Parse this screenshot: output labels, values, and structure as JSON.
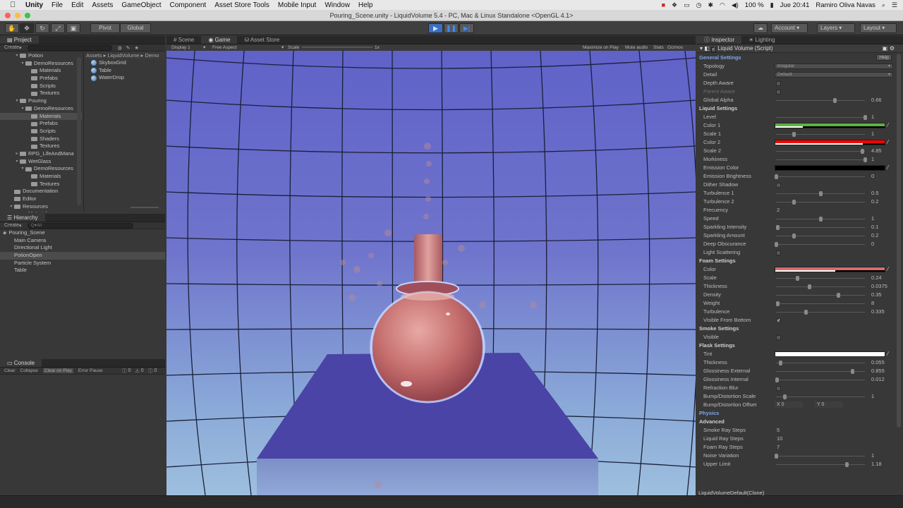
{
  "menubar": {
    "items": [
      "Unity",
      "File",
      "Edit",
      "Assets",
      "GameObject",
      "Component",
      "Asset Store Tools",
      "Mobile Input",
      "Window",
      "Help"
    ],
    "battery": "100 %",
    "clock": "Jue 20:41",
    "user": "Ramiro Oliva Navas"
  },
  "window": {
    "title": "Pouring_Scene.unity - LiquidVolume 5.4 - PC, Mac & Linux Standalone <OpenGL 4.1>"
  },
  "toolbar": {
    "pivot": "Pivot",
    "global": "Global",
    "account": "Account",
    "layers": "Layers",
    "layout": "Layout"
  },
  "project": {
    "tab": "Project",
    "create": "Create",
    "breadcrumb": "Assets ▸ LiquidVolume ▸ Demo",
    "tree": [
      {
        "label": "Potion",
        "indent": 3,
        "expanded": true
      },
      {
        "label": "DemoResources",
        "indent": 4,
        "expanded": true
      },
      {
        "label": "Materials",
        "indent": 5
      },
      {
        "label": "Prefabs",
        "indent": 5
      },
      {
        "label": "Scripts",
        "indent": 5
      },
      {
        "label": "Textures",
        "indent": 5
      },
      {
        "label": "Pouring",
        "indent": 3,
        "expanded": true
      },
      {
        "label": "DemoResources",
        "indent": 4,
        "expanded": true
      },
      {
        "label": "Materials",
        "indent": 5,
        "selected": true
      },
      {
        "label": "Prefabs",
        "indent": 5
      },
      {
        "label": "Scripts",
        "indent": 5
      },
      {
        "label": "Shaders",
        "indent": 5
      },
      {
        "label": "Textures",
        "indent": 5
      },
      {
        "label": "RPG_LifeAndMana",
        "indent": 3,
        "collapsed": true
      },
      {
        "label": "WetGlass",
        "indent": 3,
        "expanded": true
      },
      {
        "label": "DemoResources",
        "indent": 4,
        "expanded": true
      },
      {
        "label": "Materials",
        "indent": 5
      },
      {
        "label": "Textures",
        "indent": 5
      },
      {
        "label": "Documentation",
        "indent": 2
      },
      {
        "label": "Editor",
        "indent": 2
      },
      {
        "label": "Resources",
        "indent": 2,
        "expanded": true
      },
      {
        "label": "Materials",
        "indent": 3
      }
    ],
    "files": [
      "SkyboxGrid",
      "Table",
      "WaterDrop"
    ]
  },
  "hierarchy": {
    "tab": "Hierarchy",
    "create": "Create",
    "search_placeholder": "Q▾All",
    "scene": "Pouring_Scene",
    "items": [
      {
        "label": "Main Camera"
      },
      {
        "label": "Directional Light"
      },
      {
        "label": "PotionOpen",
        "selected": true
      },
      {
        "label": "Particle System"
      },
      {
        "label": "Table"
      }
    ]
  },
  "console": {
    "tab": "Console",
    "buttons": [
      "Clear",
      "Collapse",
      "Clear on Play",
      "Error Pause"
    ],
    "counts": [
      "0",
      "0",
      "0"
    ]
  },
  "game": {
    "tabs": [
      "Scene",
      "Game",
      "Asset Store"
    ],
    "display": "Display 1",
    "aspect": "Free Aspect",
    "scale_label": "Scale",
    "scale_value": "1x",
    "options": [
      "Maximize on Play",
      "Mute audio",
      "Stats",
      "Gizmos"
    ]
  },
  "inspector": {
    "tabs": [
      "Inspector",
      "Lighting"
    ],
    "component": "Liquid Volume (Script)",
    "help": "Help",
    "rows": [
      {
        "type": "section",
        "label": "General Settings",
        "link": true
      },
      {
        "type": "dropdown",
        "label": "Topology",
        "value": "Irregular"
      },
      {
        "type": "dropdown",
        "label": "Detail",
        "value": "Default"
      },
      {
        "type": "check",
        "label": "Depth Aware",
        "checked": false
      },
      {
        "type": "check",
        "label": "Parent Aware",
        "checked": false,
        "disabled": true
      },
      {
        "type": "slider",
        "label": "Global Alpha",
        "value": "0.66",
        "pos": 0.66
      },
      {
        "type": "section",
        "label": "Liquid Settings"
      },
      {
        "type": "slider",
        "label": "Level",
        "value": "1",
        "pos": 1.0
      },
      {
        "type": "color",
        "label": "Color 1",
        "color": "#5cb444",
        "alpha": 0.25
      },
      {
        "type": "slider",
        "label": "Scale 1",
        "value": "1",
        "pos": 0.2
      },
      {
        "type": "color",
        "label": "Color 2",
        "color": "#ff0000",
        "alpha": 0.8
      },
      {
        "type": "slider",
        "label": "Scale 2",
        "value": "4.85",
        "pos": 0.97
      },
      {
        "type": "slider",
        "label": "Murkiness",
        "value": "1",
        "pos": 1.0
      },
      {
        "type": "color",
        "label": "Emission Color",
        "color": "#000000",
        "alpha": 0
      },
      {
        "type": "slider",
        "label": "Emission Brightness",
        "value": "0",
        "pos": 0.0
      },
      {
        "type": "check",
        "label": "Dither Shadow",
        "checked": false
      },
      {
        "type": "slider",
        "label": "Turbulence 1",
        "value": "0.5",
        "pos": 0.5
      },
      {
        "type": "slider",
        "label": "Turbulence 2",
        "value": "0.2",
        "pos": 0.2
      },
      {
        "type": "text",
        "label": "Frecuency",
        "value": "2"
      },
      {
        "type": "slider",
        "label": "Speed",
        "value": "1",
        "pos": 0.5
      },
      {
        "type": "slider",
        "label": "Sparkling Intensity",
        "value": "0.1",
        "pos": 0.02
      },
      {
        "type": "slider",
        "label": "Sparkling Amount",
        "value": "0.2",
        "pos": 0.2
      },
      {
        "type": "slider",
        "label": "Deep Obscurance",
        "value": "0",
        "pos": 0.0
      },
      {
        "type": "check",
        "label": "Light Scattering",
        "checked": false
      },
      {
        "type": "section",
        "label": "Foam Settings"
      },
      {
        "type": "color",
        "label": "Color",
        "color": "#d86c6c",
        "alpha": 0.55
      },
      {
        "type": "slider",
        "label": "Scale",
        "value": "0.24",
        "pos": 0.24
      },
      {
        "type": "slider",
        "label": "Thickness",
        "value": "0.0375",
        "pos": 0.38
      },
      {
        "type": "slider",
        "label": "Density",
        "value": "0.35",
        "pos": 0.7
      },
      {
        "type": "slider",
        "label": "Weight",
        "value": "8",
        "pos": 0.02
      },
      {
        "type": "slider",
        "label": "Turbulence",
        "value": "0.335",
        "pos": 0.34
      },
      {
        "type": "check",
        "label": "Visible From Bottom",
        "checked": true
      },
      {
        "type": "section",
        "label": "Smoke Settings"
      },
      {
        "type": "check",
        "label": "Visible",
        "checked": false
      },
      {
        "type": "section",
        "label": "Flask Settings"
      },
      {
        "type": "color",
        "label": "Tint",
        "color": "#ffffff",
        "alpha": 1.0
      },
      {
        "type": "slider",
        "label": "Thickness",
        "value": "0.055",
        "pos": 0.05
      },
      {
        "type": "slider",
        "label": "Glossiness External",
        "value": "0.855",
        "pos": 0.86
      },
      {
        "type": "slider",
        "label": "Glossiness Internal",
        "value": "0.012",
        "pos": 0.01
      },
      {
        "type": "check",
        "label": "Refraction Blur",
        "checked": false
      },
      {
        "type": "slider",
        "label": "Bump/Distortion Scale",
        "value": "1",
        "pos": 0.1
      },
      {
        "type": "vec2",
        "label": "Bump/Distortion Offset",
        "x": "0",
        "y": "0"
      },
      {
        "type": "section",
        "label": "Physics",
        "link": true
      },
      {
        "type": "section",
        "label": "Advanced"
      },
      {
        "type": "text",
        "label": "Smoke Ray Steps",
        "value": "5"
      },
      {
        "type": "text",
        "label": "Liquid Ray Steps",
        "value": "10"
      },
      {
        "type": "text",
        "label": "Foam Ray Steps",
        "value": "7"
      },
      {
        "type": "slider",
        "label": "Noise Variation",
        "value": "1",
        "pos": 0.0
      },
      {
        "type": "slider",
        "label": "Upper Limit",
        "value": "1.18",
        "pos": 0.8
      }
    ]
  },
  "status": {
    "text": "LiquidVolumeDefault(Clone)"
  },
  "colors": {
    "accent": "#3b6fc2",
    "sky_top": "#6062c8",
    "sky_bottom": "#9ebfde",
    "table": "#4a44a6",
    "liquid": "#c46c6c"
  }
}
